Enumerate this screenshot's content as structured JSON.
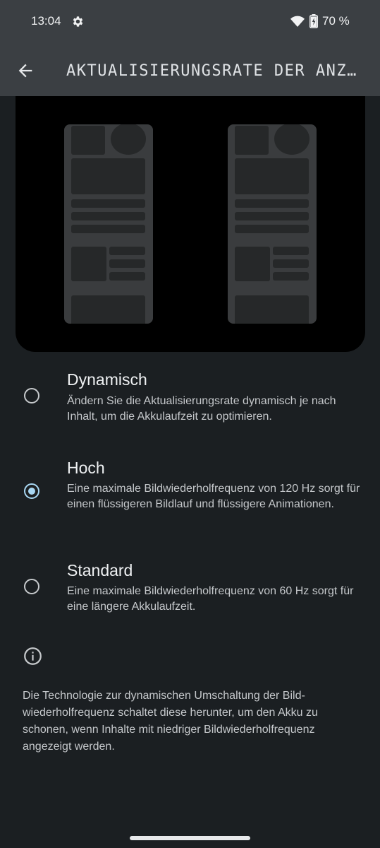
{
  "status_bar": {
    "time": "13:04",
    "battery_percent": "70 %",
    "icons": [
      "gear-icon",
      "wifi-icon",
      "battery-charging-icon"
    ]
  },
  "app_bar": {
    "back_icon": "arrow-left-icon",
    "title": "AKTUALISIERUNGSRATE DER ANZ…"
  },
  "options": [
    {
      "title": "Dynamisch",
      "description": "Ändern Sie die Aktualisierungsrate dynamisch je nach Inhalt, um die Akkulaufzeit zu optimieren.",
      "selected": false
    },
    {
      "title": "Hoch",
      "description": "Eine maximale Bildwiederholfrequenz von 120 Hz sorgt für einen flüssigeren Bildlauf und flüssigere Animationen.",
      "selected": true
    },
    {
      "title": "Standard",
      "description": "Eine maximale Bildwiederholfrequenz von 60 Hz sorgt für eine längere Akkulaufzeit.",
      "selected": false
    }
  ],
  "info": {
    "icon": "info-icon",
    "text": "Die Technologie zur dynamischen Umschaltung der Bild­wiederholfrequenz schaltet diese herunter, um den Akku zu schonen, wenn Inhalte mit niedriger Bildwiederholfrequenz angezeigt werden."
  },
  "colors": {
    "background": "#1b1f22",
    "app_bar": "#3b3f43",
    "accent": "#a8d7f3"
  }
}
